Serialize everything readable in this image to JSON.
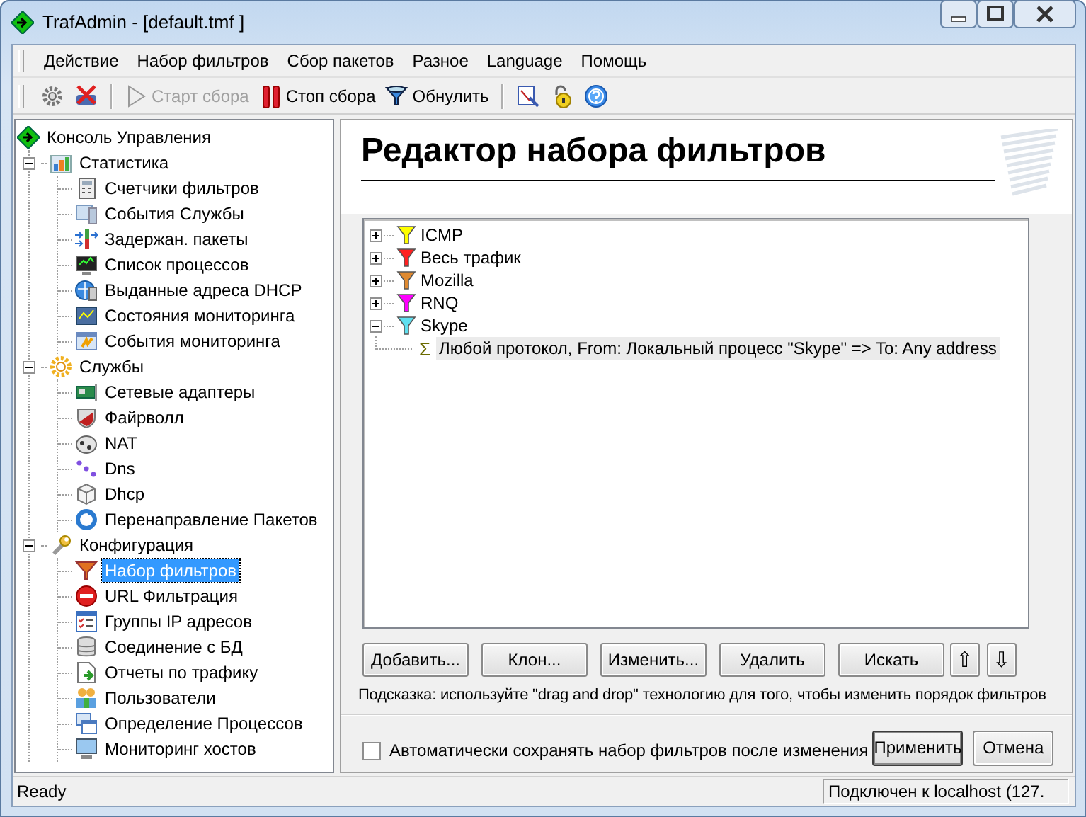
{
  "window": {
    "title": "TrafAdmin - [default.tmf ]"
  },
  "menu": [
    "Действие",
    "Набор фильтров",
    "Сбор пакетов",
    "Разное",
    "Language",
    "Помощь"
  ],
  "toolbar": [
    {
      "label": "Старт сбора",
      "disabled": true
    },
    {
      "label": "Стоп сбора",
      "disabled": false
    },
    {
      "label": "Обнулить",
      "disabled": false
    }
  ],
  "sidebar": {
    "root": {
      "label": "Консоль Управления",
      "selected": false,
      "children": [
        {
          "label": "Статистика",
          "expanded": true,
          "selected": false,
          "children": [
            {
              "label": "Счетчики фильтров",
              "selected": false
            },
            {
              "label": "События Службы",
              "selected": false
            },
            {
              "label": "Задержан. пакеты",
              "selected": false
            },
            {
              "label": "Список процессов",
              "selected": false
            },
            {
              "label": "Выданные адреса DHCP",
              "selected": false
            },
            {
              "label": "Состояния мониторинга",
              "selected": false
            },
            {
              "label": "События мониторинга",
              "selected": false
            }
          ]
        },
        {
          "label": "Службы",
          "expanded": true,
          "selected": false,
          "children": [
            {
              "label": "Сетевые адаптеры",
              "selected": false
            },
            {
              "label": "Файрволл",
              "selected": false
            },
            {
              "label": "NAT",
              "selected": false
            },
            {
              "label": "Dns",
              "selected": false
            },
            {
              "label": "Dhcp",
              "selected": false
            },
            {
              "label": "Перенаправление Пакетов",
              "selected": false
            }
          ]
        },
        {
          "label": "Конфигурация",
          "expanded": true,
          "selected": false,
          "children": [
            {
              "label": "Набор фильтров",
              "selected": true
            },
            {
              "label": "URL Фильтрация",
              "selected": false
            },
            {
              "label": "Группы IP адресов",
              "selected": false
            },
            {
              "label": "Соединение с БД",
              "selected": false
            },
            {
              "label": "Отчеты по трафику",
              "selected": false
            },
            {
              "label": "Пользователи",
              "selected": false
            },
            {
              "label": "Определение Процессов",
              "selected": false
            },
            {
              "label": "Мониторинг хостов",
              "selected": false
            }
          ]
        }
      ]
    }
  },
  "editor": {
    "title": "Редактор набора фильтров",
    "filters": [
      {
        "label": "ICMP",
        "color": "#ffff00",
        "expanded": false
      },
      {
        "label": "Весь трафик",
        "color": "#ff2020",
        "expanded": false
      },
      {
        "label": "Mozilla",
        "color": "#e08a30",
        "expanded": false
      },
      {
        "label": "RNQ",
        "color": "#ff00ff",
        "expanded": false
      },
      {
        "label": "Skype",
        "color": "#60e0f0",
        "expanded": true,
        "rules": [
          {
            "symbol": "Σ",
            "text": "Любой протокол, From: Локальный процесс \"Skype\"  => To: Any address",
            "selected": true
          }
        ]
      }
    ],
    "buttons": [
      "Добавить...",
      "Клон...",
      "Изменить...",
      "Удалить",
      "Искать"
    ],
    "move_buttons": [
      "⇧",
      "⇩"
    ],
    "hint": "Подсказка: используйте \"drag and drop\" технологию для того, чтобы изменить порядок фильтров",
    "autosave": {
      "label": "Автоматически сохранять набор фильтров после изменения",
      "checked": false
    },
    "actions": [
      {
        "label": "Применить",
        "default": true
      },
      {
        "label": "Отмена",
        "default": false
      }
    ]
  },
  "status_bar": {
    "left": "Ready",
    "right": "Подключен к localhost (127."
  }
}
